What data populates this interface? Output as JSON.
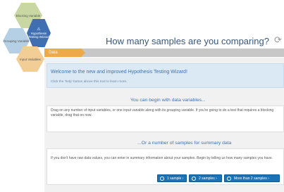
{
  "nav_hexagons": {
    "blocking": "Blocking Variable",
    "grouping": "Grouping Variable",
    "hypothesis_icon": "warning-icon",
    "hypothesis": "Hypothesis Testing Wizard",
    "input": "Input Variables"
  },
  "header": {
    "title": "How many samples are you comparing?",
    "refresh_icon": "refresh-icon"
  },
  "tabs": {
    "data": "Data"
  },
  "welcome": {
    "title": "Welcome to the new and improved Hypothesis Testing Wizard!",
    "hint": "Click the 'help' button above this tool to learn more."
  },
  "section_variables": {
    "heading": "You can begin with data variables...",
    "text": "Drag on any number of input variables, or one input variable along with its grouping variable. If you're going to do a test that requires a blocking variable, drag that on now."
  },
  "section_summary": {
    "heading": "...Or a number of samples for summary data",
    "text": "If you don't have raw data values, you can enter in summary information about your samples. Begin by telling us how many samples you have.",
    "buttons": [
      "1 sample ›",
      "2 samples ›",
      "More than 2 samples ›"
    ]
  },
  "colors": {
    "accent_blue": "#1a73b7",
    "tab_orange": "#eda94a",
    "welcome_bg": "#dbe9f5",
    "hex_blocking": "#c9d8a2",
    "hex_grouping": "#b5cfe4",
    "hex_hypothesis": "#3f6fb0",
    "hex_input": "#f2cd96"
  }
}
